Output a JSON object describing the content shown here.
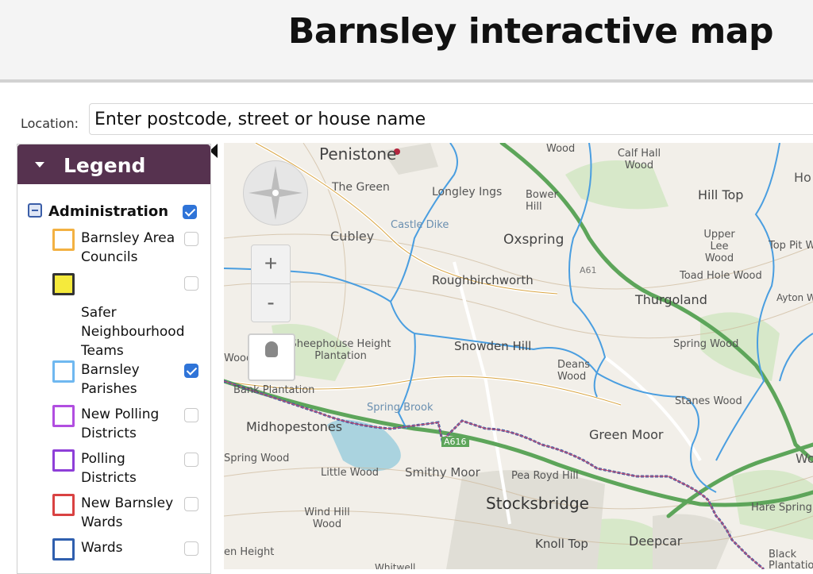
{
  "header": {
    "title": "Barnsley interactive map"
  },
  "location": {
    "label": "Location:",
    "placeholder": "Enter postcode, street or house name"
  },
  "legend": {
    "title": "Legend",
    "group": {
      "label": "Administration",
      "checked": true
    },
    "layers": [
      {
        "label": "Barnsley Area Councils",
        "swatch_color": "#f3b142",
        "swatch_fill": "#ffffff",
        "checked": false
      },
      {
        "label": "Safer Neighbourhood Teams",
        "swatch_color": "#333333",
        "swatch_fill": "#f5ea3c",
        "checked": false
      },
      {
        "label": "Barnsley Parishes",
        "swatch_color": "#6fb8f0",
        "swatch_fill": "#ffffff",
        "checked": true
      },
      {
        "label": "New Polling Districts",
        "swatch_color": "#b14ee0",
        "swatch_fill": "#ffffff",
        "checked": false
      },
      {
        "label": "Polling Districts",
        "swatch_color": "#8e3fd8",
        "swatch_fill": "#ffffff",
        "checked": false
      },
      {
        "label": "New Barnsley Wards",
        "swatch_color": "#d94242",
        "swatch_fill": "#ffffff",
        "checked": false
      },
      {
        "label": "Wards",
        "swatch_color": "#2f5fae",
        "swatch_fill": "#ffffff",
        "checked": false
      }
    ]
  },
  "map": {
    "controls": {
      "zoom_in": "+",
      "zoom_out": "-"
    },
    "places": [
      "Penistone",
      "Calf Hall Wood",
      "The Green",
      "Longley Ings",
      "Bower Hill",
      "Hill Top",
      "Castle Dike",
      "Cubley",
      "Oxspring",
      "Upper Lee Wood",
      "Top Pit W",
      "Toad Hole Wood",
      "Roughbirchworth",
      "Thurgoland",
      "Sheephouse Height Plantation",
      "Snowden Hill",
      "Spring Wood",
      "Deans Wood",
      "Bank Plantation",
      "Spring Brook",
      "Stanes Wood",
      "Midhopestones",
      "Green Moor",
      "Smithy Moor",
      "Little Wood",
      "Pea Royd Hill",
      "Stocksbridge",
      "Wind Hill Wood",
      "Hare Spring",
      "Knoll Top",
      "Deepcar",
      "Black Plantation",
      "Spring Wood",
      "Wood",
      "Wood",
      "Ho",
      "Ayton W",
      "Wo",
      "en Height",
      "Whitwell"
    ],
    "roads": [
      "A616",
      "A61"
    ]
  }
}
